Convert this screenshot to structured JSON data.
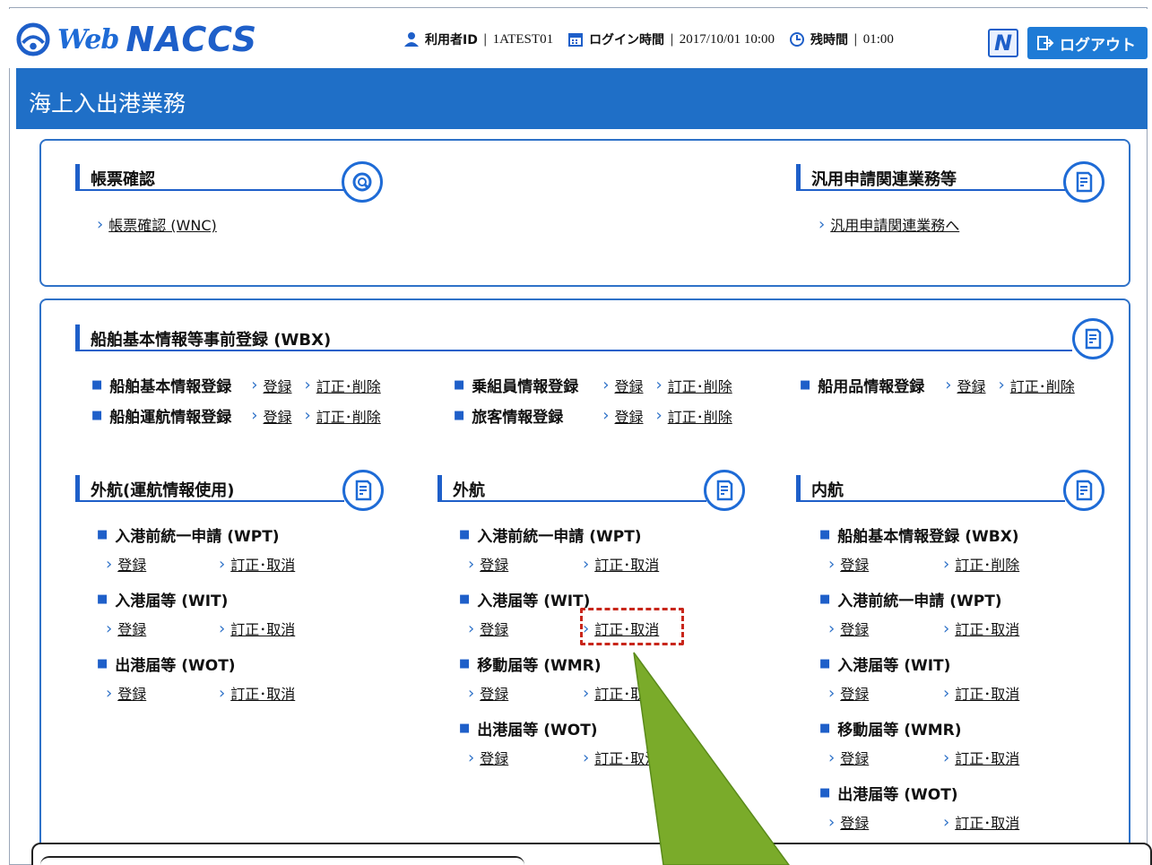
{
  "logo": {
    "web": "Web",
    "naccs": "NACCS"
  },
  "header": {
    "user_id_label": "利用者ID",
    "user_id_value": "1ATEST01",
    "login_time_label": "ログイン時間",
    "login_time_value": "2017/10/01 10:00",
    "remaining_label": "残時間",
    "remaining_value": "01:00",
    "n_button": "N",
    "logout_label": "ログアウト",
    "separator": "|"
  },
  "page_title": "海上入出港業務",
  "chevron": "›",
  "bullet": "■",
  "forms": {
    "title": "帳票確認",
    "link": "帳票確認 (WNC)"
  },
  "general": {
    "title": "汎用申請関連業務等",
    "link": "汎用申請関連業務へ"
  },
  "wbx": {
    "title": "船舶基本情報等事前登録 (WBX)",
    "rows": [
      {
        "label": "船舶基本情報登録",
        "links": [
          "登録",
          "訂正･削除"
        ]
      },
      {
        "label": "船舶運航情報登録",
        "links": [
          "登録",
          "訂正･削除"
        ]
      },
      {
        "label": "乗組員情報登録",
        "links": [
          "登録",
          "訂正･削除"
        ]
      },
      {
        "label": "旅客情報登録",
        "links": [
          "登録",
          "訂正･削除"
        ]
      },
      {
        "label": "船用品情報登録",
        "links": [
          "登録",
          "訂正･削除"
        ]
      }
    ]
  },
  "foreign_ops": {
    "title": "外航(運航情報使用)",
    "items": [
      {
        "label": "入港前統一申請 (WPT)",
        "links": [
          "登録",
          "訂正･取消"
        ]
      },
      {
        "label": "入港届等 (WIT)",
        "links": [
          "登録",
          "訂正･取消"
        ]
      },
      {
        "label": "出港届等 (WOT)",
        "links": [
          "登録",
          "訂正･取消"
        ]
      }
    ]
  },
  "foreign": {
    "title": "外航",
    "items": [
      {
        "label": "入港前統一申請 (WPT)",
        "links": [
          "登録",
          "訂正･取消"
        ]
      },
      {
        "label": "入港届等 (WIT)",
        "links": [
          "登録",
          "訂正･取消"
        ]
      },
      {
        "label": "移動届等 (WMR)",
        "links": [
          "登録",
          "訂正･取消"
        ]
      },
      {
        "label": "出港届等 (WOT)",
        "links": [
          "登録",
          "訂正･取消"
        ]
      }
    ]
  },
  "domestic": {
    "title": "内航",
    "items": [
      {
        "label": "船舶基本情報登録 (WBX)",
        "links": [
          "登録",
          "訂正･削除"
        ]
      },
      {
        "label": "入港前統一申請 (WPT)",
        "links": [
          "登録",
          "訂正･取消"
        ]
      },
      {
        "label": "入港届等 (WIT)",
        "links": [
          "登録",
          "訂正･取消"
        ]
      },
      {
        "label": "移動届等 (WMR)",
        "links": [
          "登録",
          "訂正･取消"
        ]
      },
      {
        "label": "出港届等 (WOT)",
        "links": [
          "登録",
          "訂正･取消"
        ]
      }
    ]
  },
  "colors": {
    "brand_blue": "#1e5fc9",
    "banner": "#1f6fc7",
    "highlight": "#c8261a",
    "arrow": "#7aab2a"
  }
}
